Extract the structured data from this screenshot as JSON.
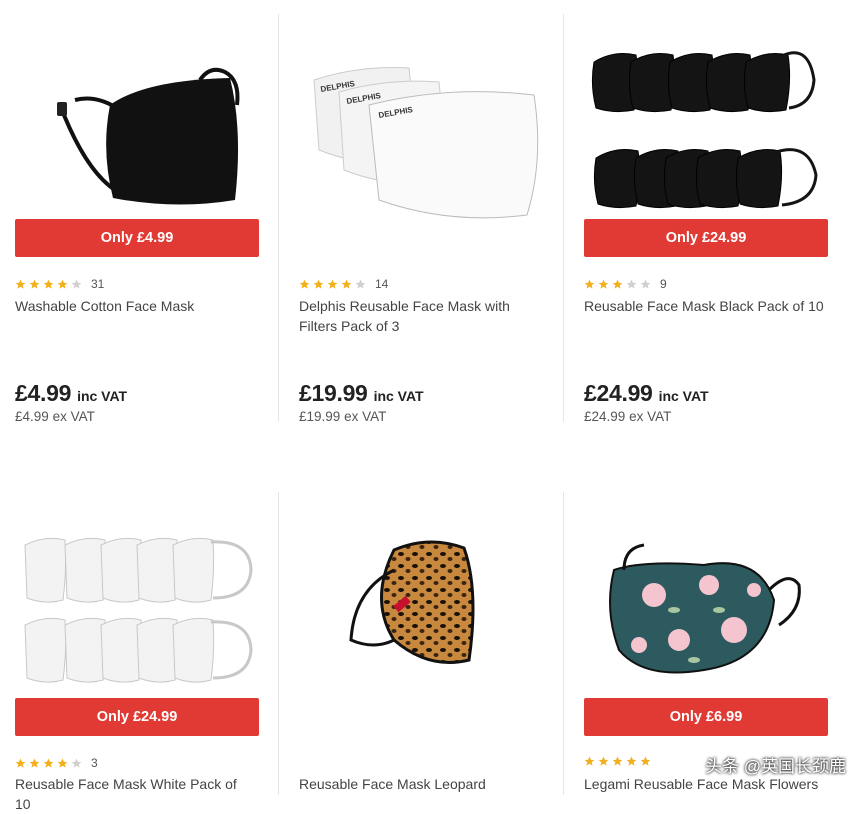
{
  "colors": {
    "badge": "#e13a35",
    "star_on": "#f2b01e",
    "star_off": "#d0d0d0"
  },
  "products": [
    {
      "offer": "Only £4.99",
      "stars": 4,
      "reviews": "31",
      "name": "Washable Cotton Face Mask",
      "price": "£4.99",
      "vat_label": "inc VAT",
      "ex_price": "£4.99",
      "ex_label": "ex VAT"
    },
    {
      "offer": "",
      "stars": 4,
      "reviews": "14",
      "name": "Delphis Reusable Face Mask with Filters Pack of 3",
      "price": "£19.99",
      "vat_label": "inc VAT",
      "ex_price": "£19.99",
      "ex_label": "ex VAT",
      "brand_print": "DELPHIS"
    },
    {
      "offer": "Only £24.99",
      "stars": 3,
      "reviews": "9",
      "name": "Reusable Face Mask Black Pack of 10",
      "price": "£24.99",
      "vat_label": "inc VAT",
      "ex_price": "£24.99",
      "ex_label": "ex VAT"
    },
    {
      "offer": "Only £24.99",
      "stars": 4,
      "reviews": "3",
      "name": "Reusable Face Mask White Pack of 10"
    },
    {
      "offer": "",
      "stars": 0,
      "reviews": "",
      "name": "Reusable Face Mask Leopard"
    },
    {
      "offer": "Only £6.99",
      "stars": 5,
      "reviews": "",
      "name": "Legami Reusable Face Mask Flowers"
    }
  ],
  "watermark": {
    "text": "头条 @英国长颈鹿"
  }
}
